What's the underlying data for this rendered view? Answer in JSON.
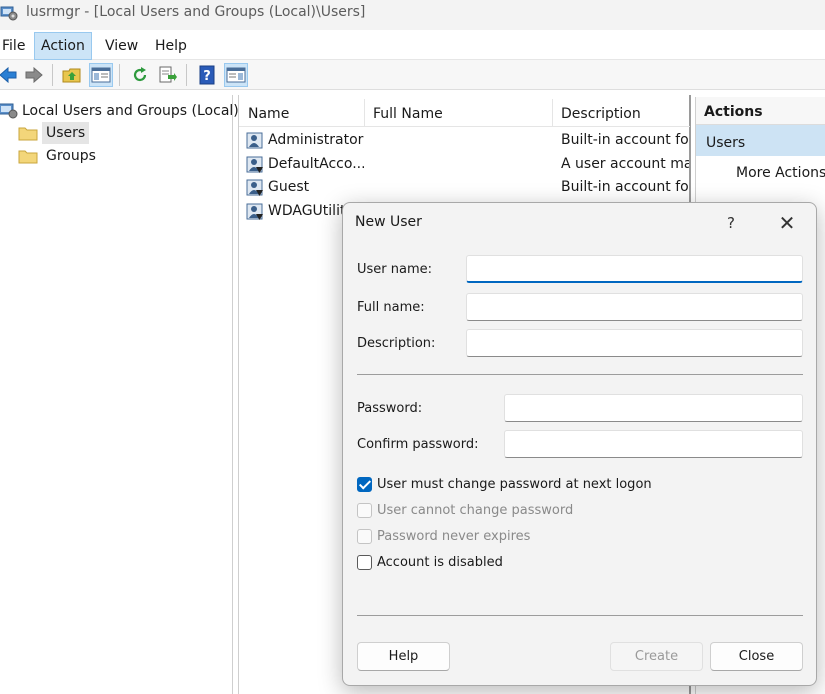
{
  "window": {
    "title": "lusrmgr - [Local Users and Groups (Local)\\Users]"
  },
  "menu": {
    "file": "File",
    "action": "Action",
    "view": "View",
    "help": "Help"
  },
  "toolbar": {
    "icons": [
      "back-icon",
      "forward-icon",
      "up-folder-icon",
      "show-hide-tree-icon",
      "refresh-icon",
      "export-list-icon",
      "help-icon",
      "show-hide-action-pane-icon"
    ]
  },
  "tree": {
    "root": "Local Users and Groups (Local)",
    "items": [
      {
        "label": "Users",
        "selected": true
      },
      {
        "label": "Groups",
        "selected": false
      }
    ]
  },
  "list": {
    "columns": [
      "Name",
      "Full Name",
      "Description"
    ],
    "rows": [
      {
        "name": "Administrator",
        "full_name": "",
        "description": "Built-in account for"
      },
      {
        "name": "DefaultAcco...",
        "full_name": "",
        "description": "A user account man"
      },
      {
        "name": "Guest",
        "full_name": "",
        "description": "Built-in account for"
      },
      {
        "name": "WDAGUtility",
        "full_name": "",
        "description": ""
      }
    ]
  },
  "actions": {
    "title": "Actions",
    "section": "Users",
    "more": "More Actions",
    "more_arrow": "▸"
  },
  "dialog": {
    "title": "New User",
    "help_glyph": "?",
    "close_glyph": "✕",
    "fields": {
      "username": {
        "label": "User name:",
        "value": ""
      },
      "fullname": {
        "label": "Full name:",
        "value": ""
      },
      "description": {
        "label": "Description:",
        "value": ""
      },
      "password": {
        "label": "Password:",
        "value": ""
      },
      "confirm": {
        "label": "Confirm password:",
        "value": ""
      }
    },
    "checkboxes": [
      {
        "label": "User must change password at next logon",
        "checked": true,
        "disabled": false
      },
      {
        "label": "User cannot change password",
        "checked": false,
        "disabled": true
      },
      {
        "label": "Password never expires",
        "checked": false,
        "disabled": true
      },
      {
        "label": "Account is disabled",
        "checked": false,
        "disabled": false
      }
    ],
    "buttons": {
      "help": "Help",
      "create": "Create",
      "close": "Close"
    }
  },
  "colors": {
    "accent": "#0067c0",
    "selection": "#cce4f7",
    "actions_section": "#cde3f4"
  }
}
